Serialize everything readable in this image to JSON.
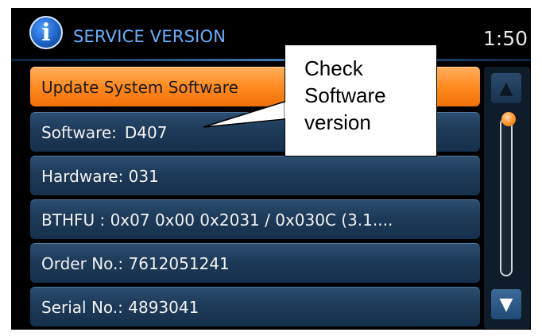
{
  "header": {
    "icon": "info-icon",
    "title": "SERVICE VERSION",
    "clock": "1:50"
  },
  "list": {
    "items": [
      {
        "label": "Update System Software",
        "selected": true
      },
      {
        "label": "Software:",
        "value": "D407"
      },
      {
        "label": "Hardware: 031"
      },
      {
        "label": "BTHFU : 0x07 0x00 0x2031 / 0x030C (3.1...."
      },
      {
        "label": "Order No.: 7612051241"
      },
      {
        "label": "Serial No.: 4893041"
      }
    ]
  },
  "scrollbar": {
    "up_icon": "arrow-up-icon",
    "down_icon": "arrow-down-icon",
    "up_glyph": "▲",
    "down_glyph": "▼"
  },
  "callout": {
    "lines": [
      "Check",
      "Software",
      "version"
    ]
  },
  "colors": {
    "accent": "#ff8a1e",
    "title": "#68b0ff",
    "row": "#1d3a58"
  }
}
